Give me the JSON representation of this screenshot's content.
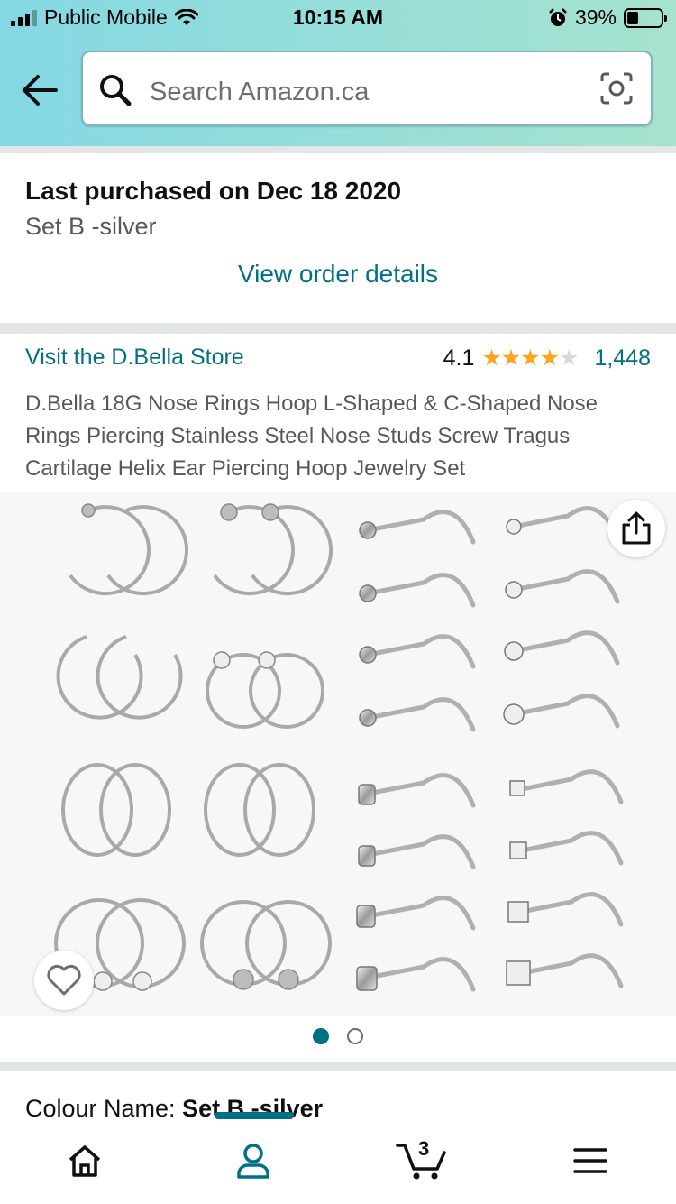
{
  "status_bar": {
    "carrier": "Public Mobile",
    "time": "10:15 AM",
    "battery": "39%",
    "battery_level": 0.39
  },
  "search": {
    "placeholder": "Search Amazon.ca"
  },
  "purchase": {
    "title": "Last purchased on Dec 18 2020",
    "variant": "Set B -silver",
    "link": "View order details"
  },
  "product": {
    "store_link": "Visit the D.Bella Store",
    "rating": "4.1",
    "stars": 4.1,
    "review_count": "1,448",
    "title": "D.Bella 18G Nose Rings Hoop L-Shaped & C-Shaped Nose Rings Piercing Stainless Steel Nose Studs Screw Tragus Cartilage Helix Ear Piercing Hoop Jewelry Set"
  },
  "gallery": {
    "image_count": 2,
    "active_index": 0
  },
  "colour": {
    "label": "Colour Name: ",
    "value": "Set B -silver"
  },
  "tabbar": {
    "cart_count": "3"
  },
  "icons": {
    "back": "back-arrow-icon",
    "search": "search-icon",
    "camera": "camera-scan-icon",
    "share": "share-icon",
    "heart": "heart-icon",
    "home": "home-icon",
    "profile": "profile-icon",
    "cart": "cart-icon",
    "menu": "menu-icon"
  },
  "colors": {
    "link": "#007185",
    "star": "#ffa41c",
    "header_start": "#84d8e3",
    "header_end": "#a6e3cf"
  }
}
